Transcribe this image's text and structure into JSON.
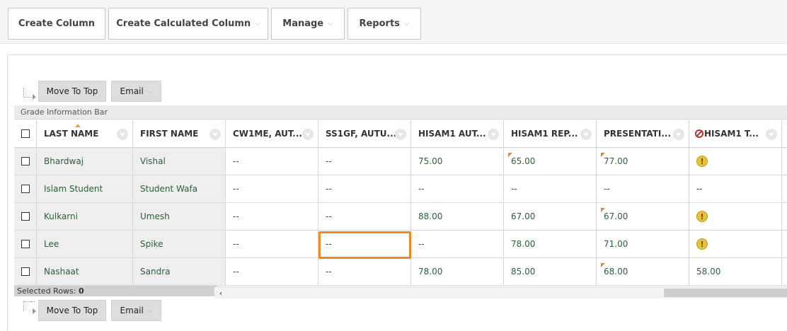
{
  "toolbar": {
    "create_column": "Create Column",
    "create_calculated_column": "Create Calculated Column",
    "manage": "Manage",
    "reports": "Reports"
  },
  "actions": {
    "move_to_top": "Move To Top",
    "email": "Email"
  },
  "info_bar": "Grade Information Bar",
  "columns": [
    "LAST NAME",
    "FIRST NAME",
    "CW1ME, AUT...",
    "SS1GF, AUTU...",
    "HISAM1 AUT...",
    "HISAM1 REP...",
    "PRESENTATI...",
    "HISAM1 T..."
  ],
  "rows": [
    {
      "last": "Bhardwaj",
      "first": "Vishal",
      "c3": "--",
      "c4": "--",
      "c5": "75.00",
      "c6": "65.00",
      "c7": "77.00",
      "c8": "!"
    },
    {
      "last": "Islam Student",
      "first": "Student Wafa",
      "c3": "--",
      "c4": "--",
      "c5": "--",
      "c6": "--",
      "c7": "--",
      "c8": "--"
    },
    {
      "last": "Kulkarni",
      "first": "Umesh",
      "c3": "--",
      "c4": "--",
      "c5": "88.00",
      "c6": "67.00",
      "c7": "67.00",
      "c8": "!"
    },
    {
      "last": "Lee",
      "first": "Spike",
      "c3": "--",
      "c4": "--",
      "c5": "--",
      "c6": "78.00",
      "c7": "71.00",
      "c8": "!"
    },
    {
      "last": "Nashaat",
      "first": "Sandra",
      "c3": "--",
      "c4": "--",
      "c5": "78.00",
      "c6": "85.00",
      "c7": "68.00",
      "c8": "58.00"
    }
  ],
  "footer": {
    "selected_label": "Selected Rows:",
    "selected_count": "0"
  },
  "scroll": {
    "left_arrow": "‹"
  },
  "colors": {
    "link_green": "#2b5f3a",
    "highlight_orange": "#f08a1f",
    "needs_grading_yellow": "#e5c23a"
  }
}
